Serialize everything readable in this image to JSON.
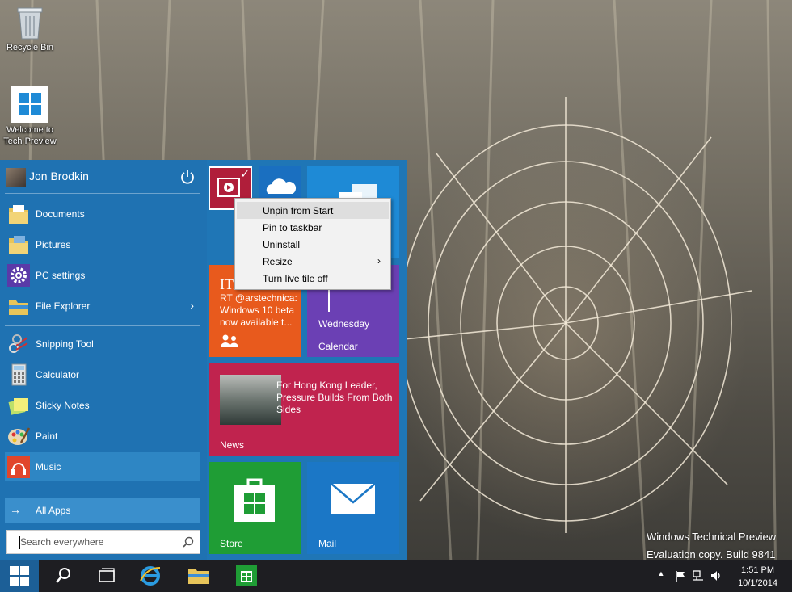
{
  "desktop": {
    "icons": [
      {
        "label": "Recycle Bin",
        "icon": "recycle-bin-icon"
      },
      {
        "label": "Welcome to Tech Preview",
        "icon": "windows-logo-icon"
      }
    ],
    "watermark": {
      "line1": "Windows Technical Preview",
      "line2": "Evaluation copy. Build 9841"
    }
  },
  "start_menu": {
    "user": {
      "name": "Jon Brodkin"
    },
    "places": [
      {
        "label": "Documents",
        "icon": "documents-folder-icon"
      },
      {
        "label": "Pictures",
        "icon": "pictures-folder-icon"
      },
      {
        "label": "PC settings",
        "icon": "gear-icon"
      },
      {
        "label": "File Explorer",
        "icon": "folder-icon",
        "arrow": "›"
      }
    ],
    "apps": [
      {
        "label": "Snipping Tool",
        "icon": "scissors-icon"
      },
      {
        "label": "Calculator",
        "icon": "calculator-icon"
      },
      {
        "label": "Sticky Notes",
        "icon": "sticky-note-icon"
      },
      {
        "label": "Paint",
        "icon": "palette-icon"
      },
      {
        "label": "Music",
        "icon": "headphones-icon"
      }
    ],
    "all_apps": {
      "label": "All Apps",
      "arrow": "→"
    },
    "search": {
      "placeholder": "Search everywhere"
    },
    "tiles": {
      "twitter": {
        "big": "ITr",
        "message": "RT @arstechnica: Windows 10 beta now available t..."
      },
      "calendar": {
        "day": "Wednesday",
        "label": "Calendar"
      },
      "news": {
        "headline": "For Hong Kong Leader, Pressure Builds From Both Sides",
        "label": "News"
      },
      "store": {
        "label": "Store"
      },
      "mail": {
        "label": "Mail"
      },
      "video": {
        "check": "✓"
      }
    }
  },
  "context_menu": {
    "items": [
      {
        "label": "Unpin from Start",
        "highlighted": true
      },
      {
        "label": "Pin to taskbar"
      },
      {
        "label": "Uninstall"
      },
      {
        "label": "Resize",
        "submenu": "›"
      },
      {
        "label": "Turn live tile off"
      }
    ]
  },
  "taskbar": {
    "buttons": [
      "start-button",
      "search-button",
      "task-view-button",
      "internet-explorer-button",
      "file-explorer-button",
      "store-button"
    ],
    "tray": {
      "up_arrow": "▲"
    },
    "clock": {
      "time": "1:51 PM",
      "date": "10/1/2014"
    }
  },
  "colors": {
    "start_bg": "#1f76b6",
    "tile_orange": "#e85a1d",
    "tile_purple": "#6b40b4",
    "tile_news": "#c0234e",
    "tile_store": "#1f9d35",
    "tile_mail": "#1b77c6"
  }
}
